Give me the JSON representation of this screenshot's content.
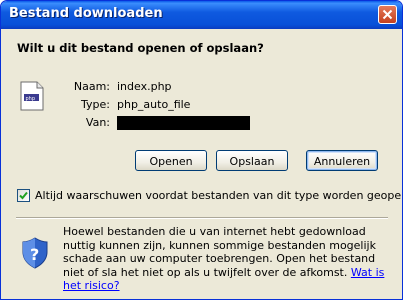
{
  "window": {
    "title": "Bestand downloaden"
  },
  "dialog": {
    "question": "Wilt u dit bestand openen of opslaan?",
    "file": {
      "name_label": "Naam:",
      "name_value": "index.php",
      "type_label": "Type:",
      "type_value": "php_auto_file",
      "from_label": "Van:"
    },
    "buttons": {
      "open": "Openen",
      "save": "Opslaan",
      "cancel": "Annuleren"
    },
    "checkbox": {
      "label": "Altijd waarschuwen voordat bestanden van dit type worden geopend",
      "checked": true
    },
    "warning": {
      "text": "Hoewel bestanden die u van internet hebt gedownload nuttig kunnen zijn, kunnen sommige bestanden mogelijk schade aan uw computer toebrengen. Open het bestand niet of sla het niet op als u twijfelt over de afkomst. ",
      "link": "Wat is het risico?"
    }
  },
  "icons": [
    "close-icon",
    "php-file-icon",
    "checkmark-icon",
    "security-shield-icon"
  ],
  "colors": {
    "titlebar": "#0a5ae8",
    "dialog_bg": "#ece9d8",
    "close": "#c4411f",
    "link": "#0000ff"
  }
}
